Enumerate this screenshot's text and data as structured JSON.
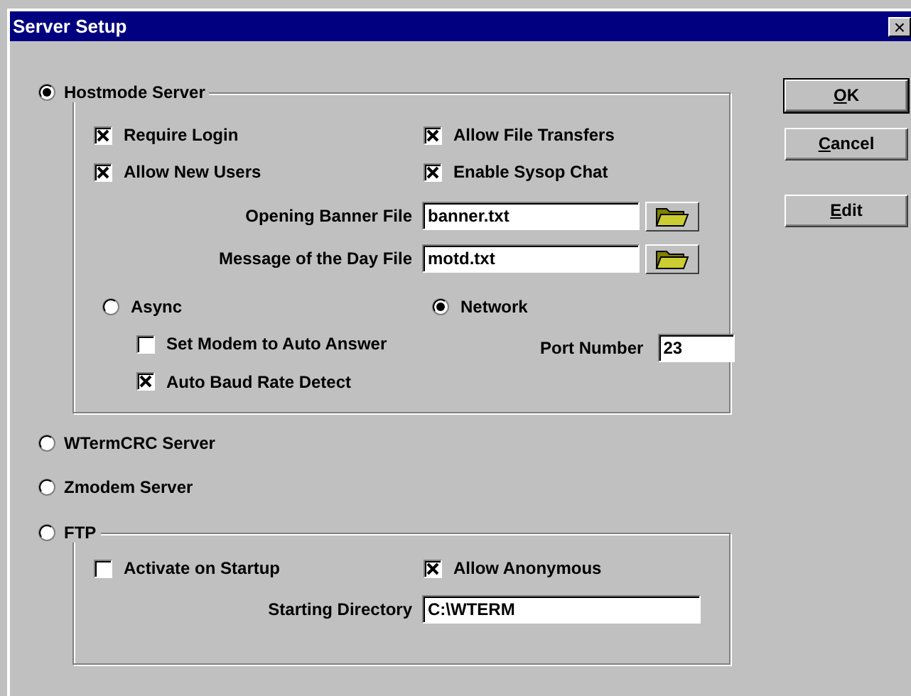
{
  "window": {
    "title": "Server Setup",
    "close": "×"
  },
  "hostmode": {
    "label": "Hostmode Server",
    "selected": true,
    "options": [
      {
        "label": "Require Login",
        "checked": true
      },
      {
        "label": "Allow File Transfers",
        "checked": true
      },
      {
        "label": "Allow New Users",
        "checked": true
      },
      {
        "label": "Enable Sysop Chat",
        "checked": true
      }
    ],
    "files": [
      {
        "label": "Opening Banner File",
        "value": "banner.txt"
      },
      {
        "label": "Message of the Day File",
        "value": "motd.txt"
      }
    ],
    "connection": [
      {
        "label": "Async",
        "selected": false
      },
      {
        "label": "Network",
        "selected": true
      }
    ],
    "async_options": [
      {
        "label": "Set Modem to Auto Answer",
        "checked": false
      },
      {
        "label": "Auto Baud Rate Detect",
        "checked": true
      }
    ],
    "port": {
      "label": "Port Number",
      "value": "23"
    }
  },
  "other_servers": [
    {
      "label": "WTermCRC Server",
      "selected": false
    },
    {
      "label": "Zmodem Server",
      "selected": false
    }
  ],
  "ftp": {
    "label": "FTP",
    "selected": false,
    "options": [
      {
        "label": "Activate on Startup",
        "checked": false
      },
      {
        "label": "Allow Anonymous",
        "checked": true
      }
    ],
    "directory": {
      "label": "Starting Directory",
      "value": "C:\\WTERM"
    }
  },
  "buttons": [
    {
      "key": "O",
      "rest": "K",
      "default": true
    },
    {
      "key": "C",
      "rest": "ancel",
      "default": false
    },
    {
      "key": "E",
      "rest": "dit",
      "default": false
    }
  ]
}
